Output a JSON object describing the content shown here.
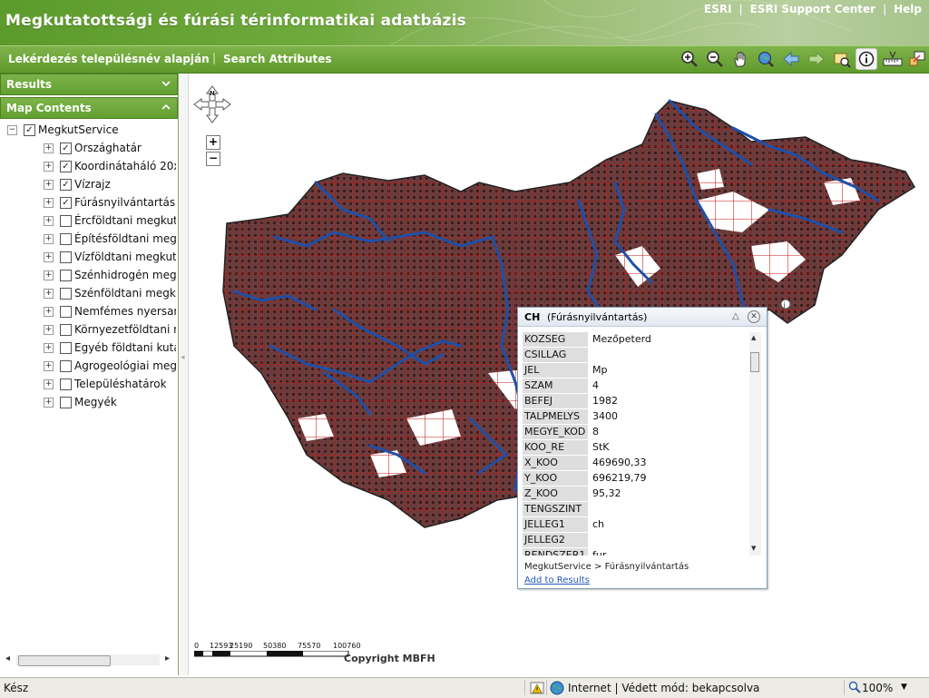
{
  "header": {
    "title": "Megkutatottsági és fúrási térinformatikai adatbázis",
    "links": [
      "ESRI",
      "ESRI Support Center",
      "Help"
    ]
  },
  "toolbar": {
    "tasks": [
      "Lekérdezés településnév alapján",
      "Search Attributes"
    ],
    "tools": [
      "zoom-in-icon",
      "zoom-out-icon",
      "pan-hand-icon",
      "full-extent-icon",
      "back-arrow-icon",
      "forward-arrow-icon",
      "map-window-icon",
      "identify-icon",
      "measure-icon",
      "overview-icon"
    ],
    "active_tool": "identify-icon"
  },
  "panels": {
    "results_label": "Results",
    "map_contents_label": "Map Contents"
  },
  "toc": {
    "service": "MegkutService",
    "layers": [
      {
        "label": "Országhatár",
        "checked": true
      },
      {
        "label": "Koordinátaháló 20x",
        "checked": true
      },
      {
        "label": "Vízrajz",
        "checked": true
      },
      {
        "label": "Fúrásnyilvántartás",
        "checked": true
      },
      {
        "label": "Ércföldtani megkuta",
        "checked": false
      },
      {
        "label": "Építésföldtani megk",
        "checked": false
      },
      {
        "label": "Vízföldtani megkuta",
        "checked": false
      },
      {
        "label": "Szénhidrogén megk",
        "checked": false
      },
      {
        "label": "Szénföldtani megku",
        "checked": false
      },
      {
        "label": "Nemfémes nyersan",
        "checked": false
      },
      {
        "label": "Környezetföldtani m",
        "checked": false
      },
      {
        "label": "Egyéb földtani kutat",
        "checked": false
      },
      {
        "label": "Agrogeológiai megk",
        "checked": false
      },
      {
        "label": "Településhatárok",
        "checked": false
      },
      {
        "label": "Megyék",
        "checked": false
      }
    ]
  },
  "map": {
    "compass_label": "N",
    "scale_labels": [
      "0",
      "12593",
      "25190",
      "50380",
      "75570",
      "100760"
    ],
    "copyright": "Copyright MBFH",
    "colors": {
      "terrain": "#6b3a3a",
      "grid": "#c41a1a",
      "rivers": "#1f4fa8",
      "dots": "#3c1e1e"
    }
  },
  "popup": {
    "type_code": "CH",
    "layer_title": "(Fúrásnyilvántartás)",
    "attributes": [
      {
        "key": "KOZSEG",
        "value": "Mezőpeterd"
      },
      {
        "key": "CSILLAG",
        "value": ""
      },
      {
        "key": "JEL",
        "value": "Mp"
      },
      {
        "key": "SZAM",
        "value": "4"
      },
      {
        "key": "BEFEJ",
        "value": "1982"
      },
      {
        "key": "TALPMELYS",
        "value": "3400"
      },
      {
        "key": "MEGYE_KOD",
        "value": "8"
      },
      {
        "key": "KOO_RE",
        "value": "StK"
      },
      {
        "key": "X_KOO",
        "value": "469690,33"
      },
      {
        "key": "Y_KOO",
        "value": "696219,79"
      },
      {
        "key": "Z_KOO",
        "value": "95,32"
      },
      {
        "key": "TENGSZINT",
        "value": ""
      },
      {
        "key": "JELLEG1",
        "value": "ch"
      },
      {
        "key": "JELLEG2",
        "value": ""
      },
      {
        "key": "RENDSZER1",
        "value": "fur"
      }
    ],
    "path": "MegkutService > Fúrásnyilvántartás",
    "add_to_results": "Add to Results"
  },
  "statusbar": {
    "status": "Kész",
    "zone": "Internet | Védett mód: bekapcsolva",
    "zoom": "100%"
  }
}
